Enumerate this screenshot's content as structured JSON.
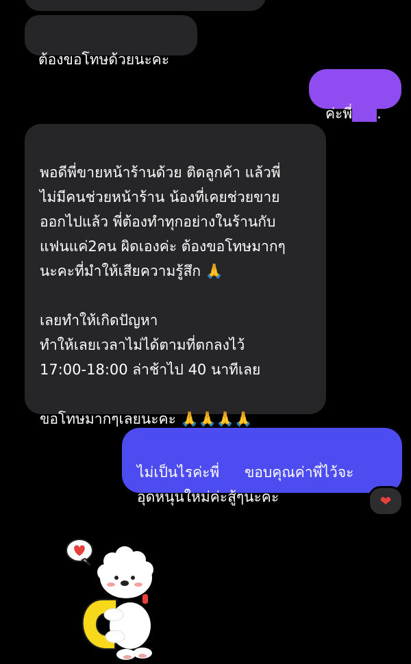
{
  "messages": [
    {
      "id": "top-partial",
      "direction": "incoming",
      "text": ""
    },
    {
      "id": "apology",
      "direction": "incoming",
      "text": "ต้องขอโทษด้วยนะคะ"
    },
    {
      "id": "ok",
      "direction": "outgoing",
      "text_before": "ค่ะพี่",
      "text_after": "."
    },
    {
      "id": "long",
      "direction": "incoming",
      "text": "พอดีพี่ขายหน้าร้านด้วย ติดลูกค้า แล้วพี่\nไม่มีคนช่วยหน้าร้าน น้องที่เคยช่วยขาย\nออกไปแล้ว พี่ต้องทำทุกอย่างในร้านกับ\nแฟนแค่2คน ผิดเองค่ะ ต้องขอโทษมากๆ\nนะคะที่มำให้เสียความรู้สึก 🙏\n\nเลยทำให้เกิดปัญหา\nทำให้เลยเวลาไม่ได้ตามที่ตกลงไว้\n17:00-18:00 ล่าช้าไป 40 นาทีเลย\n\nขอโทษมากๆเลยนะคะ 🙏🙏🙏🙏"
    },
    {
      "id": "reply",
      "direction": "outgoing",
      "text_before": "ไม่เป็นไรค่ะพี่",
      "text_after": " ขอบคุณค่าพี่ไว้จะ\nอุดหนุนใหม่ค่ะสู้ๆนะคะ",
      "reaction": "❤"
    }
  ],
  "sticker": {
    "icon": "bear-hug-sticker-icon"
  },
  "colors": {
    "incoming_bubble": "#262628",
    "outgoing_purple": "#8f4cf0",
    "outgoing_blue": "#4d4cf0",
    "heart": "#e8403a"
  }
}
